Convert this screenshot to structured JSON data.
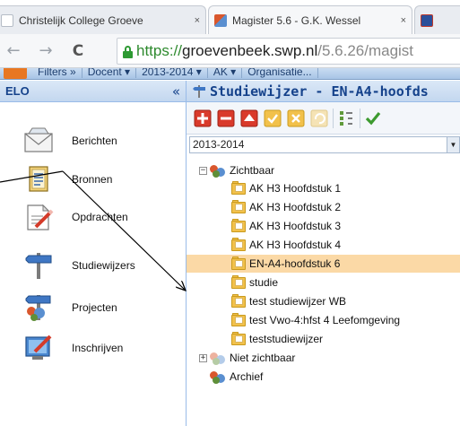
{
  "browser": {
    "tabs": [
      {
        "title": "Christelijk College Groeve",
        "close": "×",
        "active": false
      },
      {
        "title": "Magister 5.6 - G.K. Wessel",
        "close": "×",
        "active": true
      },
      {
        "title": "",
        "close": "",
        "active": false
      }
    ],
    "nav": {
      "back": "←",
      "forward": "→",
      "reload": "C"
    },
    "url": {
      "scheme": "https://",
      "host": "groevenbeek.swp.nl",
      "path": "/5.6.26/magist"
    }
  },
  "filterbar": {
    "items": [
      "Filters »",
      "Docent ▾",
      "2013-2014 ▾",
      "AK ▾",
      "Organisatie..."
    ]
  },
  "sidebar": {
    "title": "ELO",
    "collapse": "«",
    "items": [
      {
        "label": "Berichten",
        "icon": "envelope-icon"
      },
      {
        "label": "Bronnen",
        "icon": "document-icon"
      },
      {
        "label": "Opdrachten",
        "icon": "assignment-icon"
      },
      {
        "label": "Studiewijzers",
        "icon": "signpost-icon"
      },
      {
        "label": "Projecten",
        "icon": "project-signpost-icon"
      },
      {
        "label": "Inschrijven",
        "icon": "enroll-icon"
      }
    ]
  },
  "main": {
    "title": "Studiewijzer - EN-A4-hoofds",
    "year": "2013-2014",
    "dropdown_arrow": "▼",
    "tree": {
      "visible_group": {
        "label": "Zichtbaar",
        "expander": "⊟"
      },
      "items": [
        "AK H3 Hoofdstuk 1",
        "AK H3 Hoofdstuk 2",
        "AK H3 Hoofdstuk 3",
        "AK H3 Hoofdstuk 4",
        "EN-A4-hoofdstuk 6",
        "studie",
        "test studiewijzer WB",
        "test Vwo-4:hfst 4 Leefomgeving",
        "teststudiewijzer"
      ],
      "selected_index": 4,
      "hidden_group": {
        "label": "Niet zichtbaar",
        "expander": "⊞"
      },
      "archive": {
        "label": "Archief"
      }
    }
  },
  "colors": {
    "accent_blue": "#15428b",
    "selection": "#fbd9a6",
    "secure_green": "#2e9a33"
  }
}
